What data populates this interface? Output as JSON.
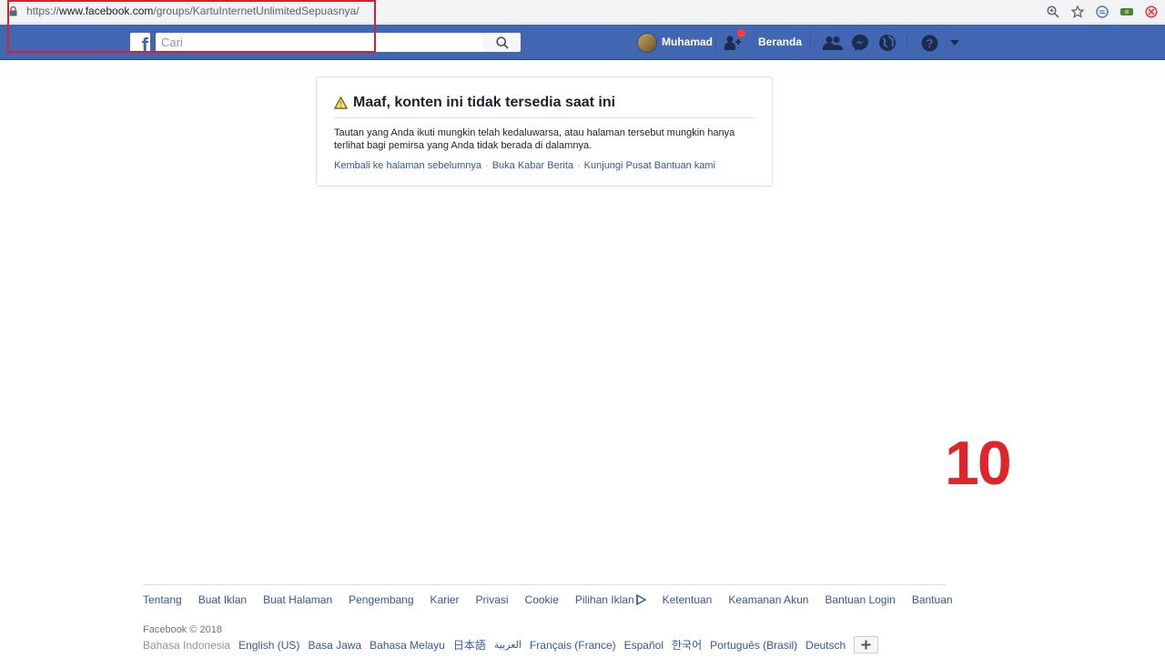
{
  "browser": {
    "url_prefix": "https://",
    "url_host": "www.facebook.com",
    "url_path": "/groups/KartuInternetUnlimitedSepuasnya/"
  },
  "header": {
    "search_placeholder": "Cari",
    "user_name": "Muhamad",
    "home_label": "Beranda",
    "brand_color": "#4267b2"
  },
  "card": {
    "title": "Maaf, konten ini tidak tersedia saat ini",
    "message": "Tautan yang Anda ikuti mungkin telah kedaluwarsa, atau halaman tersebut mungkin hanya terlihat bagi pemirsa yang Anda tidak berada di dalamnya.",
    "links": [
      "Kembali ke halaman sebelumnya",
      "Buka Kabar Berita",
      "Kunjungi Pusat Bantuan kami"
    ],
    "separator": "·"
  },
  "annotation": {
    "number": "10"
  },
  "footer": {
    "links": [
      "Tentang",
      "Buat Iklan",
      "Buat Halaman",
      "Pengembang",
      "Karier",
      "Privasi",
      "Cookie",
      "Pilihan Iklan",
      "Ketentuan",
      "Keamanan Akun",
      "Bantuan Login",
      "Bantuan"
    ],
    "copyright": "Facebook © 2018",
    "current_language": "Bahasa Indonesia",
    "languages": [
      "English (US)",
      "Basa Jawa",
      "Bahasa Melayu",
      "日本語",
      "العربية",
      "Français (France)",
      "Español",
      "한국어",
      "Português (Brasil)",
      "Deutsch"
    ]
  }
}
